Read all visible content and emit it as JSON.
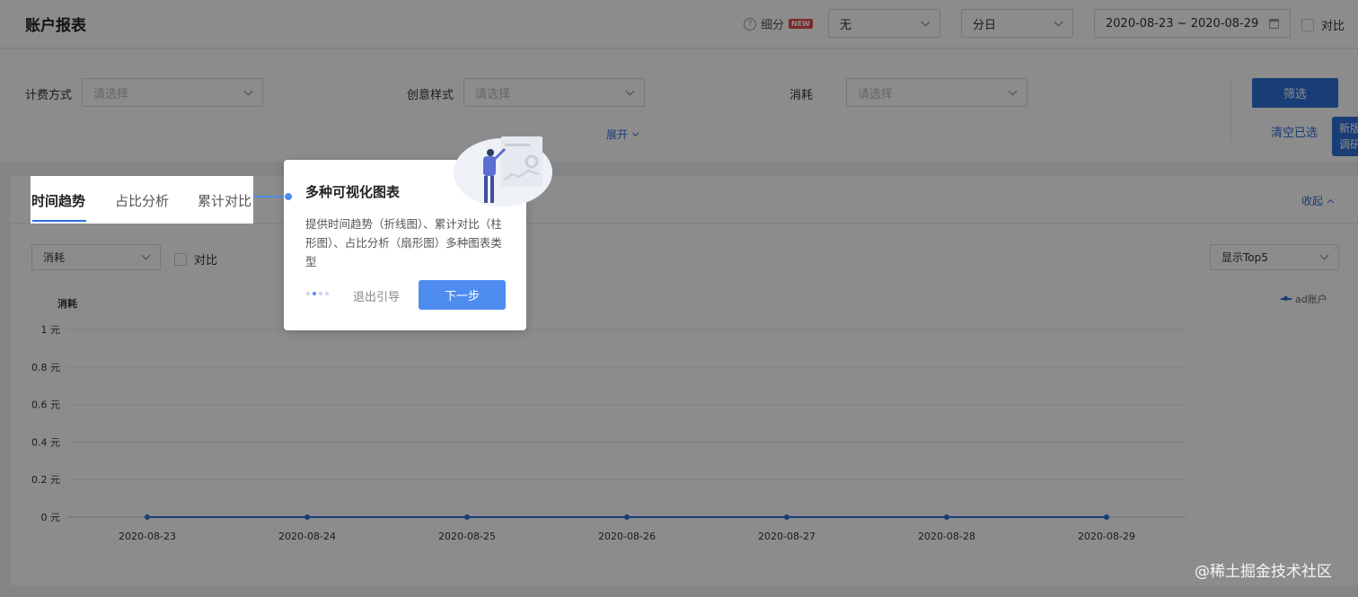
{
  "header": {
    "title": "账户报表",
    "refine_label": "细分",
    "new_badge": "NEW",
    "breakdown_value": "无",
    "granularity_value": "分日",
    "date_range": "2020-08-23 ~ 2020-08-29",
    "compare_label": "对比"
  },
  "filters": {
    "billing_label": "计费方式",
    "billing_placeholder": "请选择",
    "creative_label": "创意样式",
    "creative_placeholder": "请选择",
    "cost_label": "消耗",
    "cost_placeholder": "请选择",
    "expand_label": "展开",
    "submit_label": "筛选",
    "clear_label": "清空已选",
    "side_tab_label": "新版调研"
  },
  "chart_card": {
    "tabs": [
      {
        "label": "时间趋势",
        "active": true
      },
      {
        "label": "占比分析",
        "active": false
      },
      {
        "label": "累计对比",
        "active": false
      }
    ],
    "collapse_label": "收起",
    "metric_value": "消耗",
    "compare_label": "对比",
    "topn_value": "显示Top5"
  },
  "guide": {
    "title": "多种可视化图表",
    "description": "提供时间趋势（折线图）、累计对比（柱形图）、占比分析（扇形图）多种图表类型",
    "step_total": 4,
    "step_current": 2,
    "exit_label": "退出引导",
    "next_label": "下一步"
  },
  "colors": {
    "primary": "#2f6fd8",
    "guide_accent": "#4f8cf0",
    "badge_red": "#e5484d"
  },
  "watermark": "@稀土掘金技术社区",
  "chart_data": {
    "type": "line",
    "title": "",
    "xlabel": "",
    "ylabel": "消耗",
    "x": [
      "2020-08-23",
      "2020-08-24",
      "2020-08-25",
      "2020-08-26",
      "2020-08-27",
      "2020-08-28",
      "2020-08-29"
    ],
    "y_ticks": [
      "0 元",
      "0.2 元",
      "0.4 元",
      "0.6 元",
      "0.8 元",
      "1 元"
    ],
    "ylim": [
      0,
      1
    ],
    "grid": true,
    "legend_position": "top-right",
    "series": [
      {
        "name": "ad账户",
        "values": [
          0,
          0,
          0,
          0,
          0,
          0,
          0
        ]
      }
    ]
  }
}
